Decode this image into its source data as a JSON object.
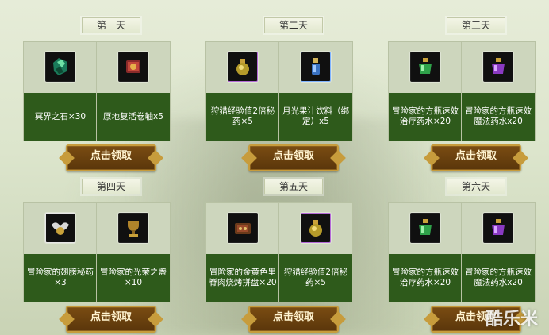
{
  "days": [
    {
      "title": "第一天",
      "items": [
        {
          "label": "冥界之石×30",
          "icon": "gem-icon",
          "color": "#1a7a5a"
        },
        {
          "label": "原地复活卷轴x5",
          "icon": "scroll-icon",
          "color": "#8a2a2a"
        }
      ],
      "button": "点击领取"
    },
    {
      "title": "第二天",
      "items": [
        {
          "label": "狩猎经验值2倍秘药×5",
          "icon": "potion-icon",
          "color": "#b59b2a"
        },
        {
          "label": "月光果汁饮料（绑定）x5",
          "icon": "bottle-icon",
          "color": "#3a72c2"
        }
      ],
      "button": "点击领取"
    },
    {
      "title": "第三天",
      "items": [
        {
          "label": "冒险家的方瓶速效治疗药水×20",
          "icon": "green-potion-icon",
          "color": "#2fa24a"
        },
        {
          "label": "冒险家的方瓶速效魔法药水x20",
          "icon": "purple-potion-icon",
          "color": "#8a3ac2"
        }
      ],
      "button": "点击领取"
    },
    {
      "title": "第四天",
      "items": [
        {
          "label": "冒险家的翅膀秘药×3",
          "icon": "wing-potion-icon",
          "color": "#d8d8d8"
        },
        {
          "label": "冒险家的光荣之盏×10",
          "icon": "chalice-icon",
          "color": "#b0842a"
        }
      ],
      "button": "点击领取"
    },
    {
      "title": "第五天",
      "items": [
        {
          "label": "冒险家的金黄色里脊肉烧烤拼盘×20",
          "icon": "food-platter-icon",
          "color": "#9a4a2a"
        },
        {
          "label": "狩猎经验值2倍秘药×5",
          "icon": "potion-icon",
          "color": "#b59b2a"
        }
      ],
      "button": "点击领取"
    },
    {
      "title": "第六天",
      "items": [
        {
          "label": "冒险家的方瓶速效治疗药水×20",
          "icon": "green-potion-icon",
          "color": "#2fa24a"
        },
        {
          "label": "冒险家的方瓶速效魔法药水x20",
          "icon": "purple-potion-icon",
          "color": "#8a3ac2"
        }
      ],
      "button": "点击领取"
    }
  ],
  "watermark": "酷乐米"
}
